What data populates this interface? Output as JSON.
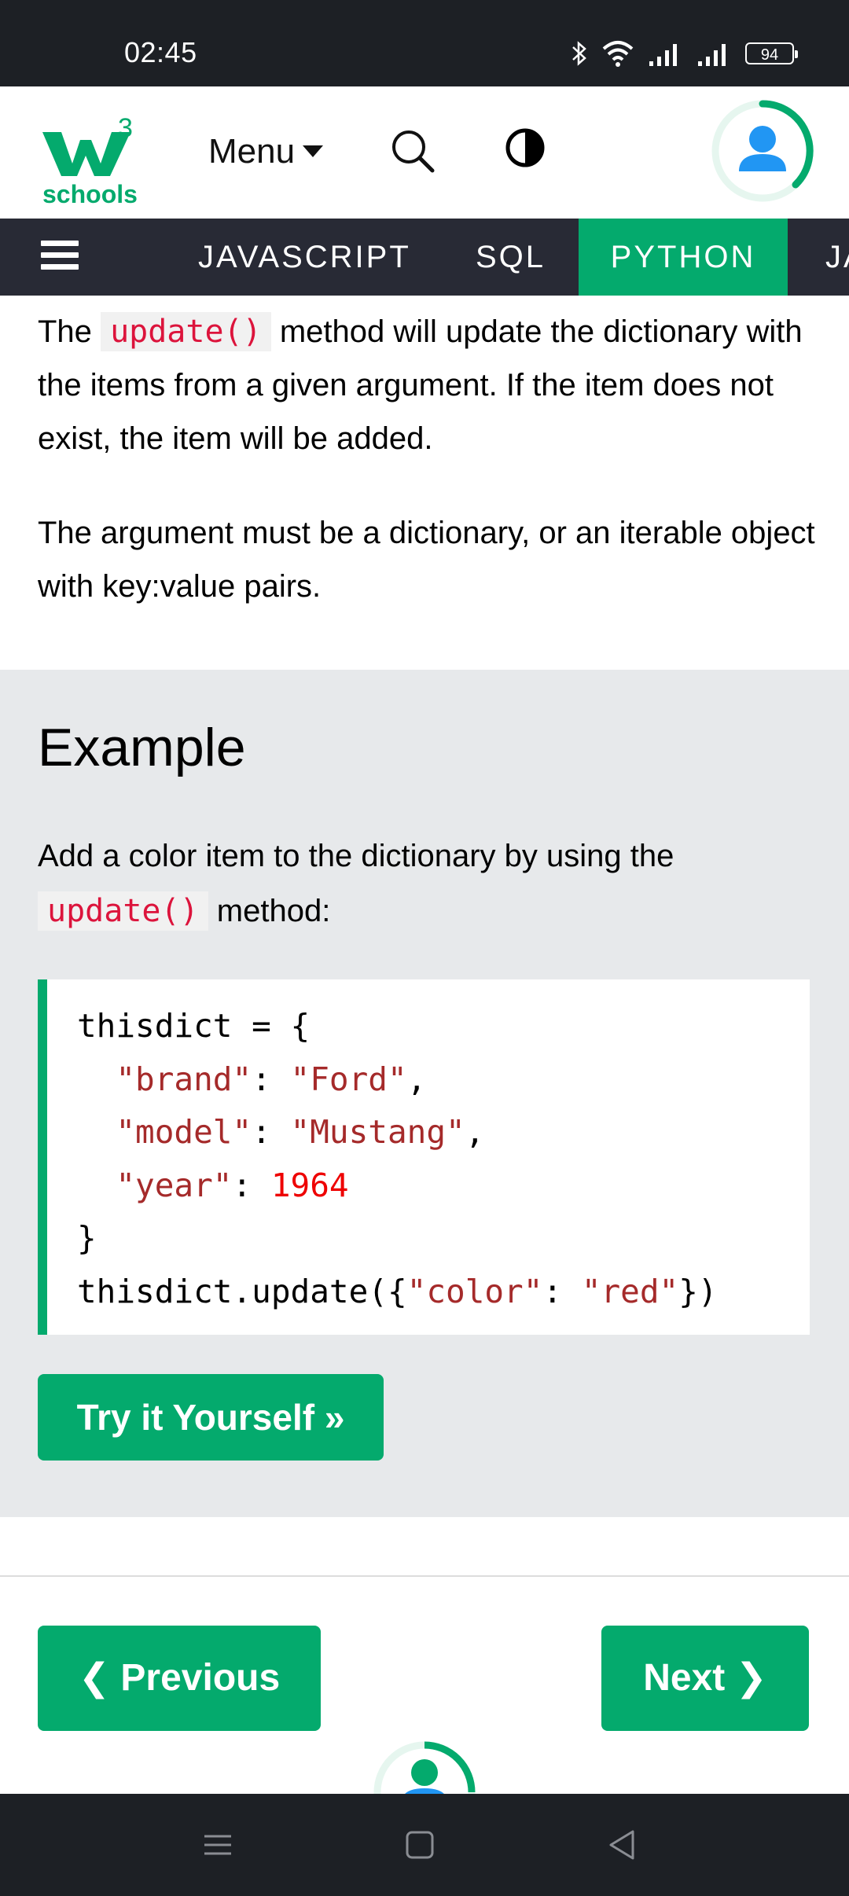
{
  "status_bar": {
    "time": "02:45",
    "battery": "94",
    "icons": [
      "bluetooth-icon",
      "wifi-icon",
      "signal-icon",
      "signal-icon"
    ]
  },
  "header": {
    "logo_number": "3",
    "logo_text": "schools",
    "menu_label": "Menu",
    "brand_color": "#04aa6d"
  },
  "subnav": {
    "tabs": [
      {
        "label": "JAVASCRIPT",
        "active": false
      },
      {
        "label": "SQL",
        "active": false
      },
      {
        "label": "PYTHON",
        "active": true
      },
      {
        "label": "JA",
        "active": false
      }
    ]
  },
  "intro": {
    "p1_before": "The",
    "p1_code": "update()",
    "p1_after": "method will update the dictionary with the items from a given argument. If the item does not exist, the item will be added.",
    "p2": "The argument must be a dictionary, or an iterable object with key:value pairs."
  },
  "example": {
    "title": "Example",
    "desc_before": "Add a color item to the dictionary by using the",
    "desc_code": "update()",
    "desc_after": "method:",
    "code": {
      "l1": "thisdict = {",
      "l2_key": "\"brand\"",
      "l2_sep": ": ",
      "l2_val": "\"Ford\"",
      "l2_end": ",",
      "l3_key": "\"model\"",
      "l3_sep": ": ",
      "l3_val": "\"Mustang\"",
      "l3_end": ",",
      "l4_key": "\"year\"",
      "l4_sep": ": ",
      "l4_val": "1964",
      "l5": "}",
      "l6_a": "thisdict.update({",
      "l6_key": "\"color\"",
      "l6_sep": ": ",
      "l6_val": "\"red\"",
      "l6_end": "})"
    },
    "try_button": "Try it Yourself »"
  },
  "pagination": {
    "previous": "❮ Previous",
    "next": "Next ❯"
  },
  "nav_bar": {
    "icons": [
      "menu-icon",
      "home-icon",
      "back-icon"
    ]
  }
}
